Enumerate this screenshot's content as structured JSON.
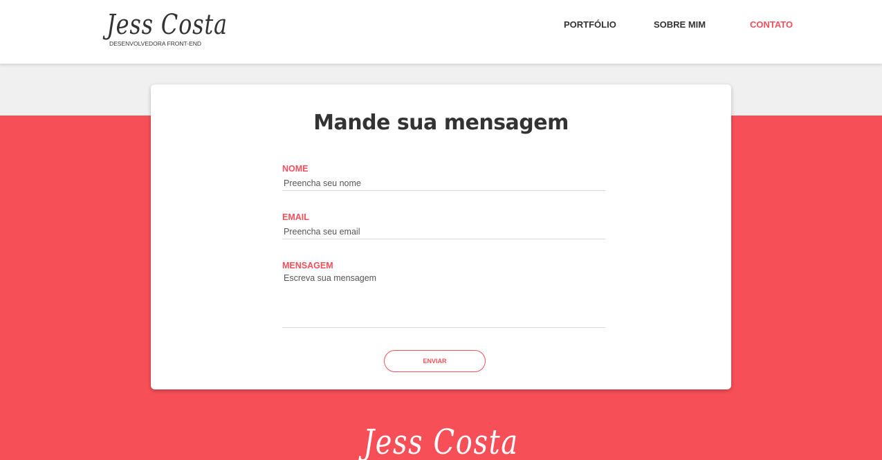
{
  "header": {
    "logo_name": "Jess Costa",
    "logo_tagline": "DESENVOLVEDORA FRONT-END",
    "nav": [
      {
        "label": "PORTFÓLIO",
        "active": false
      },
      {
        "label": "SOBRE MIM",
        "active": false
      },
      {
        "label": "CONTATO",
        "active": true
      }
    ]
  },
  "form": {
    "title": "Mande sua mensagem",
    "fields": [
      {
        "label": "NOME",
        "placeholder": "Preencha seu nome",
        "value": ""
      },
      {
        "label": "EMAIL",
        "placeholder": "Preencha seu email",
        "value": ""
      },
      {
        "label": "MENSAGEM",
        "placeholder": "Escreva sua mensagem",
        "value": ""
      }
    ],
    "submit_label": "ENVIAR"
  },
  "footer": {
    "logo_name": "Jess Costa"
  },
  "colors": {
    "accent": "#f24f5a",
    "band": "#f74f58",
    "text": "#333333",
    "background": "#f0f0f0"
  }
}
